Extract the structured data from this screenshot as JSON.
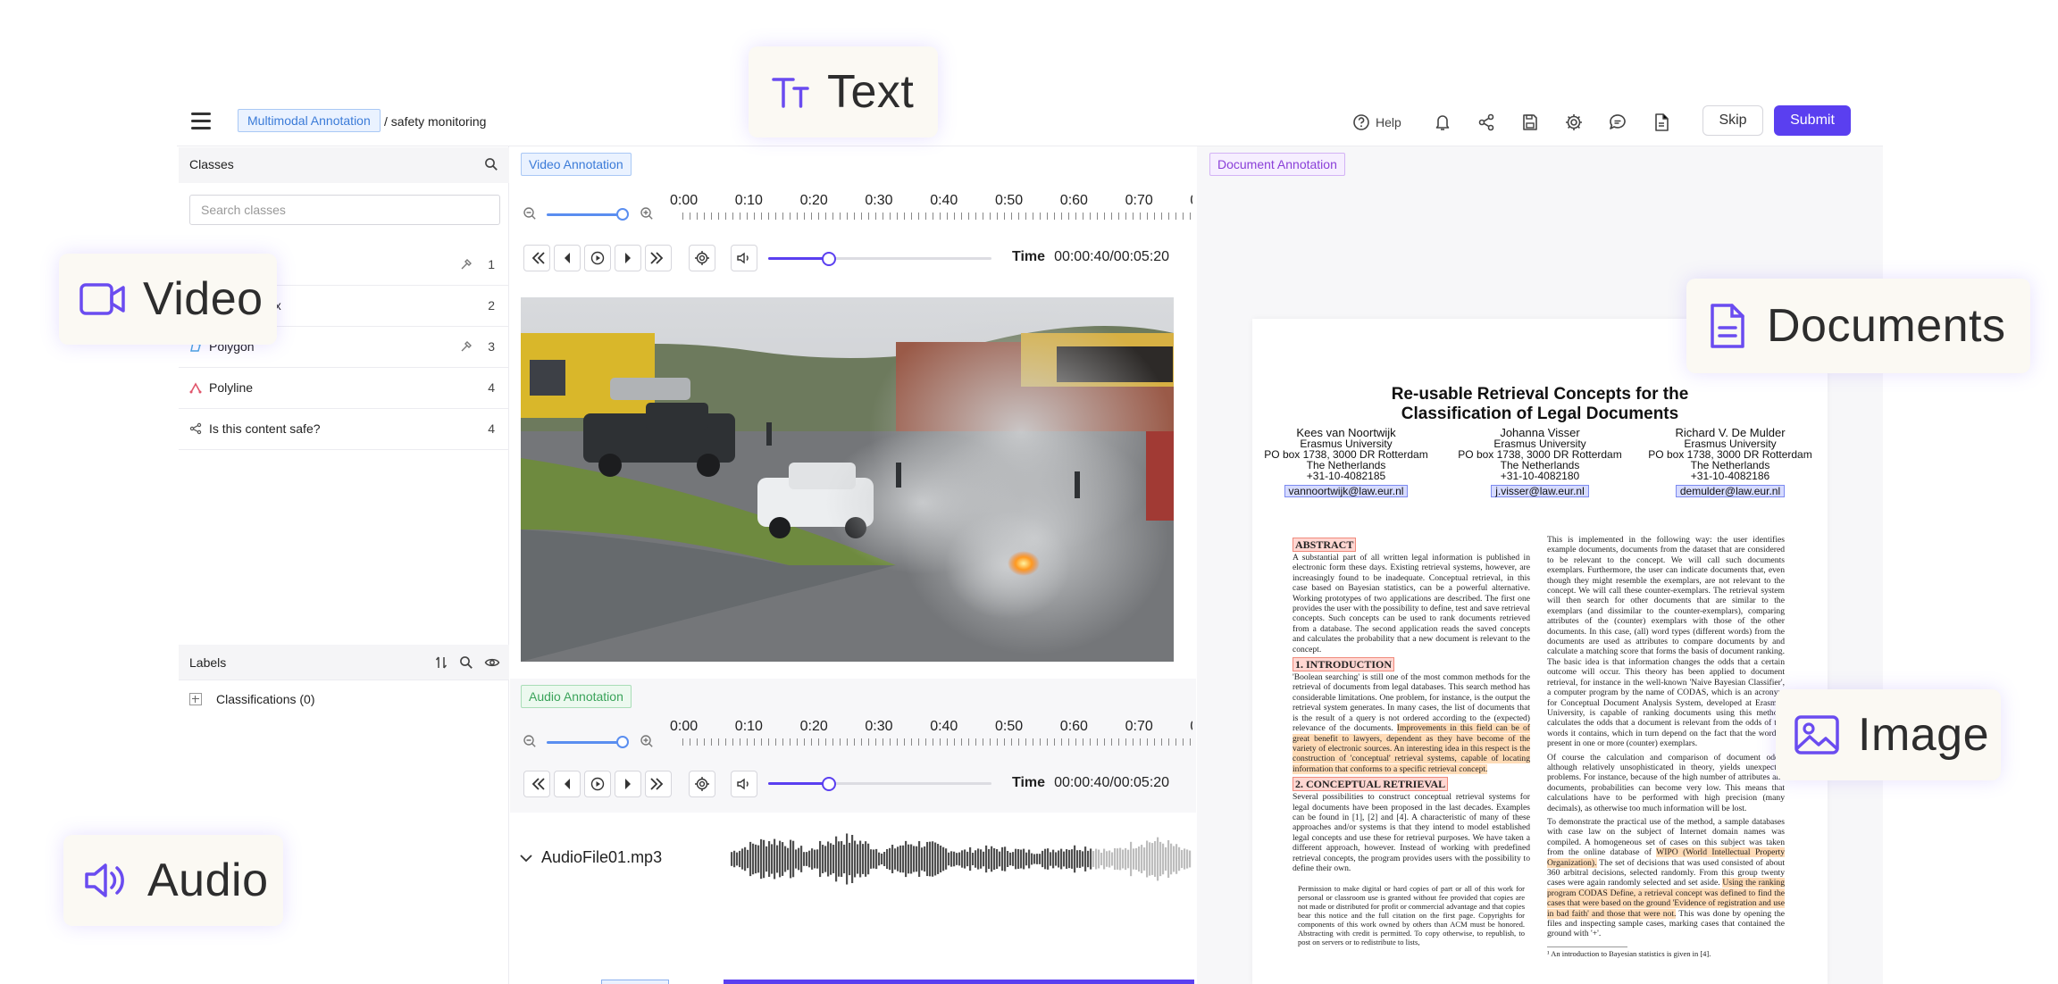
{
  "header": {
    "project_tag": "Multimodal Annotation",
    "project_path": "/ safety monitoring",
    "help_label": "Help",
    "skip_label": "Skip",
    "submit_label": "Submit"
  },
  "classes": {
    "title": "Classes",
    "search_placeholder": "Search classes",
    "items": [
      {
        "label": "",
        "count": "1"
      },
      {
        "label": "ox",
        "count": "2"
      },
      {
        "label": "Polygon",
        "count": "3"
      },
      {
        "label": "Polyline",
        "count": "4"
      },
      {
        "label": "Is this content safe?",
        "count": "4"
      }
    ]
  },
  "labels": {
    "title": "Labels",
    "classifications": "Classifications (0)"
  },
  "video": {
    "tag": "Video Annotation",
    "timeline": [
      "0:00",
      "0:10",
      "0:20",
      "0:30",
      "0:40",
      "0:50",
      "0:60",
      "0:70",
      "0"
    ],
    "time_label": "Time",
    "time_value": "00:00:40/00:05:20",
    "progress": 0.27
  },
  "audio": {
    "tag": "Audio Annotation",
    "timeline": [
      "0:00",
      "0:10",
      "0:20",
      "0:30",
      "0:40",
      "0:50",
      "0:60",
      "0:70",
      "0"
    ],
    "time_label": "Time",
    "time_value": "00:00:40/00:05:20",
    "progress": 0.27,
    "file_name": "AudioFile01.mp3"
  },
  "document": {
    "tag": "Document Annotation",
    "title_line1": "Re-usable Retrieval Concepts for the",
    "title_line2": "Classification of Legal Documents",
    "authors": [
      {
        "name": "Kees van Noortwijk",
        "affil": "Erasmus University",
        "addr": "PO box 1738, 3000 DR Rotterdam",
        "country": "The Netherlands",
        "phone": "+31-10-4082185",
        "email": "vannoortwijk@law.eur.nl"
      },
      {
        "name": "Johanna Visser",
        "affil": "Erasmus University",
        "addr": "PO box 1738, 3000 DR Rotterdam",
        "country": "The Netherlands",
        "phone": "+31-10-4082180",
        "email": "j.visser@law.eur.nl"
      },
      {
        "name": "Richard V. De Mulder",
        "affil": "Erasmus University",
        "addr": "PO box 1738, 3000 DR Rotterdam",
        "country": "The Netherlands",
        "phone": "+31-10-4082186",
        "email": "demulder@law.eur.nl"
      }
    ],
    "abstract_heading": "ABSTRACT",
    "abstract_text": "A substantial part of all written legal information is published in electronic form these days. Existing retrieval systems, however, are increasingly found to be inadequate. Conceptual retrieval, in this case based on Bayesian statistics, can be a powerful alternative. Working prototypes of two applications are described. The first one provides the user with the possibility to define, test and save retrieval concepts. Such concepts can be used to rank documents retrieved from a database. The second application reads the saved concepts and calculates the probability that a new document is relevant to the concept.",
    "intro_heading": "1.  INTRODUCTION",
    "intro_text_a": "'Boolean searching' is still one of the most common methods for the retrieval of documents from legal databases. This search method has considerable limitations. One problem, for instance, is the output the retrieval system generates. In many cases, the list of documents that is the result of a query is not ordered according to the (expected) relevance of the documents.",
    "intro_text_hl": "Improvements in this field can be of great benefit to lawyers, dependent as they have become of the variety of electronic sources. An interesting idea in this respect is the construction of 'conceptual' retrieval systems, capable of locating information that conforms to a specific retrieval concept.",
    "concept_heading": "2.  CONCEPTUAL RETRIEVAL",
    "concept_text": "Several possibilities to construct conceptual retrieval systems for legal documents have been proposed in the last decades. Examples can be found in [1], [2] and [4]. A characteristic of many of these approaches and/or systems is that they intend to model established legal concepts and use these for retrieval purposes. We have taken a different approach, however. Instead of working with predefined retrieval concepts, the program provides users with the possibility to define their own.",
    "permission_text": "Permission to make digital or hard copies of part or all of this work for personal or classroom use is granted without fee provided that copies are not made or distributed for profit or commercial advantage and that copies bear this notice and the full citation on the first page. Copyrights for components of this work owned by others than ACM must be honored. Abstracting with credit is permitted. To copy otherwise, to republish, to post on servers or to redistribute to lists,",
    "right_text_1": "This is implemented in the following way: the user identifies example documents, documents from the dataset that are considered to be relevant to the concept. We will call such documents exemplars. Furthermore, the user can indicate documents that, even though they might resemble the exemplars, are not relevant to the concept. We will call these counter-exemplars. The retrieval system will then search for other documents that are similar to the exemplars (and dissimilar to the counter-exemplars), comparing attributes of the (counter) exemplars with those of the other documents. In this case, (all) word types (different words) from the documents are used as attributes to compare documents by and calculate a matching score that forms the basis of document ranking. The basic idea is that information changes the odds that a certain outcome will occur. This theory has been applied to document retrieval, for instance in the well-known 'Naive Bayesian Classifier', a computer program by the name of CODAS, which is an acronym for Conceptual Document Analysis System, developed at Erasmus University, is capable of ranking documents using this method: calculates the odds that a document is relevant from the odds of the words it contains, which in turn depend on the fact that the word is present in one or more (counter) exemplars.",
    "right_text_2": "Of course the calculation and comparison of document odds, although relatively unsophisticated in theory, yields unexpected problems. For instance, because of the high number of attributes and documents, probabilities can become very low. This means that calculations have to be performed with high precision (many decimals), as otherwise too much information will be lost.",
    "right_text_3a": "To demonstrate the practical use of the method, a sample databases with case law on the subject of Internet domain names was compiled. A homogeneous set of cases on this subject was taken from the online database of",
    "right_text_3hl": "WIPO (World Intellectual Property Organization).",
    "right_text_3b": "The set of decisions that was used consisted of about 360 arbitral decisions, selected randomly. From this group twenty cases were again randomly selected and set aside.",
    "right_text_3hl2": "Using the ranking program CODAS Define, a retrieval concept was defined to find the cases that were based on the ground 'Evidence of registration and use in bad faith' and those that were not.",
    "right_text_3c": "This was done by opening the files and inspecting sample cases, marking cases that contained the ground with '+'.",
    "footnote": "¹ An introduction to Bayesian statistics is given in [4]."
  },
  "feature_cards": {
    "text": "Text",
    "video": "Video",
    "documents": "Documents",
    "image": "Image",
    "audio": "Audio"
  },
  "colors": {
    "accent": "#5a3ff0",
    "icon_purple": "#6a4cf0",
    "tag_blue": "#3b7bd8",
    "tag_green": "#3aa35a",
    "tag_purple": "#8a3fd8"
  }
}
